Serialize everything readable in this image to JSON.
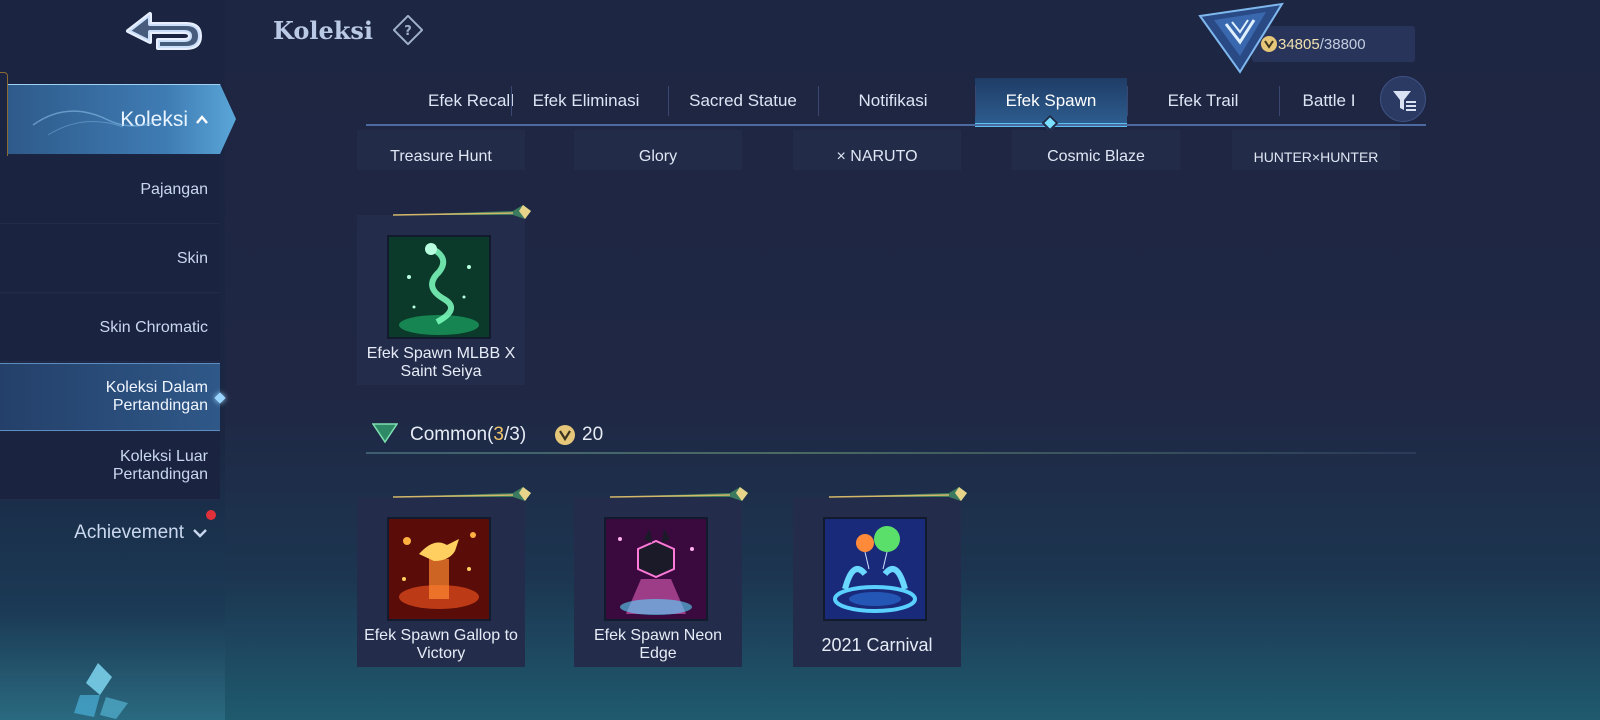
{
  "header": {
    "title": "Koleksi",
    "points_current": "34805",
    "points_separator": "/",
    "points_max": "38800"
  },
  "sidebar": {
    "active_label": "Koleksi",
    "items": [
      {
        "label": "Pajangan"
      },
      {
        "label": "Skin"
      },
      {
        "label": "Skin Chromatic"
      },
      {
        "label": "Koleksi Dalam Pertandingan"
      },
      {
        "label": "Koleksi Luar Pertandingan"
      }
    ],
    "achievement_label": "Achievement"
  },
  "tabs": [
    {
      "label": "Efek Recall"
    },
    {
      "label": "Efek Eliminasi"
    },
    {
      "label": "Sacred Statue"
    },
    {
      "label": "Notifikasi"
    },
    {
      "label": "Efek Spawn"
    },
    {
      "label": "Efek Trail"
    },
    {
      "label": "Battle I"
    }
  ],
  "top_row": [
    {
      "label": "Treasure Hunt"
    },
    {
      "label": "Glory"
    },
    {
      "label": "× NARUTO"
    },
    {
      "label": "Cosmic Blaze"
    },
    {
      "label": "HUNTER×HUNTER"
    }
  ],
  "special_items": [
    {
      "label": "Efek Spawn MLBB X Saint Seiya"
    }
  ],
  "common_section": {
    "label": "Common(",
    "owned": "3",
    "total": "/3)",
    "points": "20"
  },
  "common_items": [
    {
      "label": "Efek Spawn Gallop to Victory"
    },
    {
      "label": "Efek Spawn Neon Edge"
    },
    {
      "label": "2021 Carnival"
    }
  ],
  "colors": {
    "accent": "#59c0f0",
    "gold": "#f2c46a",
    "notification": "#e0313a"
  }
}
